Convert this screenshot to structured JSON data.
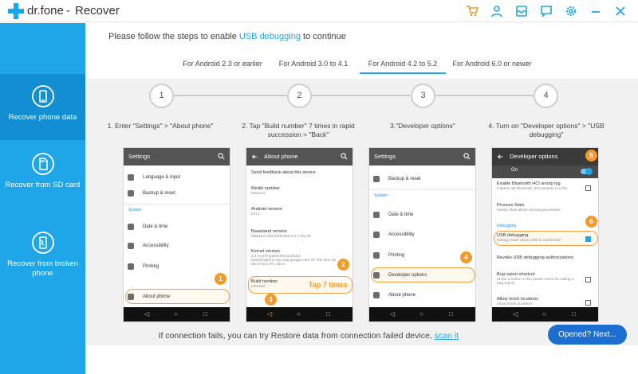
{
  "titlebar": {
    "app_name": "dr.fone",
    "separator": "-",
    "mode": "Recover",
    "icons": [
      "cart-icon",
      "user-icon",
      "mail-icon",
      "feedback-icon",
      "settings-icon",
      "minimize-icon",
      "close-icon"
    ]
  },
  "sidebar": {
    "items": [
      {
        "label": "Recover phone data",
        "icon": "phone-recover-icon",
        "active": true
      },
      {
        "label": "Recover from SD card",
        "icon": "sd-card-icon",
        "active": false
      },
      {
        "label": "Recover from broken phone",
        "icon": "broken-phone-icon",
        "active": false
      }
    ]
  },
  "main": {
    "instruction_prefix": "Please follow the steps to enable",
    "instruction_link": "USB debugging",
    "instruction_suffix": "to continue",
    "tabs": [
      {
        "label": "For Android 2.3 or earlier",
        "active": false
      },
      {
        "label": "For Android 3.0 to 4.1",
        "active": false
      },
      {
        "label": "For Android 4.2 to 5.2",
        "active": true
      },
      {
        "label": "For Android 6.0 or newer",
        "active": false
      }
    ],
    "steps": [
      {
        "number": "1",
        "title": "1. Enter \"Settings\" > \"About phone\""
      },
      {
        "number": "2",
        "title": "2. Tap \"Build number\" 7    times in rapid succession > \"Back\""
      },
      {
        "number": "3",
        "title": "3.\"Developer options\""
      },
      {
        "number": "4",
        "title": "4. Turn on \"Developer      options\" > \"USB debugging\""
      }
    ]
  },
  "phones": {
    "p1": {
      "title": "Settings",
      "rows": [
        "Language & input",
        "Backup & reset"
      ],
      "section": "System",
      "rows2": [
        "Date & time",
        "Accessibility",
        "Printing",
        "About phone"
      ],
      "badge": "1"
    },
    "p2": {
      "title": "About phone",
      "items": [
        {
          "t": "Send feedback about this device",
          "s": ""
        },
        {
          "t": "Model number",
          "s": "Nexus 4"
        },
        {
          "t": "Android version",
          "s": "5.0.1"
        },
        {
          "t": "Baseband version",
          "s": "M9615A-CEFWMAZM-2.0.1701.05"
        },
        {
          "t": "Kernel version",
          "s": "3.4.0-perf-g16e235d android-build@vpbs1.mtv.corp.google.com #1 Thu Nov 25 05:47:52 UTC 2014"
        },
        {
          "t": "Build number",
          "s": "LRX22C"
        }
      ],
      "tap_label": "Tap 7 times",
      "badge2": "2",
      "badge3": "3"
    },
    "p3": {
      "title": "Settings",
      "rows": [
        "Backup & reset"
      ],
      "section": "System",
      "rows2": [
        "Date & time",
        "Accessibility",
        "Printing",
        "Developer options",
        "About phone"
      ],
      "badge": "4"
    },
    "p4": {
      "title": "Developer options",
      "on_label": "On",
      "items": [
        {
          "t": "Enable Bluetooth HCI snoop log",
          "s": "Capture all bluetooth HCI packets in a file"
        },
        {
          "t": "Process Stats",
          "s": "Geeky stats about running processes"
        },
        {
          "t": "USB debugging",
          "s": "Debug mode when USB is connected"
        },
        {
          "t": "Revoke USB debugging authorizations",
          "s": ""
        },
        {
          "t": "Bug report shortcut",
          "s": "Show a button in the power menu for taking a bug report"
        },
        {
          "t": "Allow mock locations",
          "s": "Allow mock locations"
        }
      ],
      "section": "Debugging",
      "badge5": "5",
      "badge6": "6"
    }
  },
  "footer": {
    "text": "If connection fails, you can try Restore data from connection failed device,",
    "link": "scan it",
    "button": "Opened? Next..."
  },
  "colors": {
    "accent": "#1ea6e8",
    "sidebar_active": "#128fd2",
    "badge": "#f39a2a",
    "button": "#1c6fd0"
  }
}
